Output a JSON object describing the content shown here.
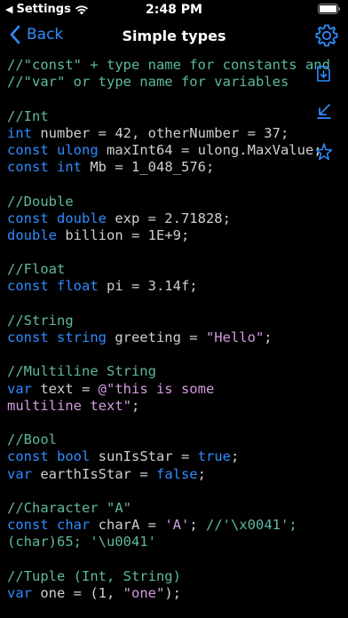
{
  "status": {
    "back_app": "Settings",
    "time": "2:48 PM"
  },
  "nav": {
    "back_label": "Back",
    "title": "Simple types"
  },
  "colors": {
    "accent": "#2f8cff",
    "comment": "#5fb8a0",
    "string": "#d39be0",
    "text": "#cfcfcf",
    "background": "#000000"
  },
  "icons": {
    "settings": "gear-icon",
    "tool1": "page-export-icon",
    "tool2": "collapse-arrow-icon",
    "tool3": "sparkle-star-icon"
  },
  "code": {
    "lines": [
      [
        {
          "t": "comment",
          "v": "//\"const\" + type name for constants and"
        }
      ],
      [
        {
          "t": "comment",
          "v": "//\"var\" or type name for variables"
        }
      ],
      [],
      [
        {
          "t": "comment",
          "v": "//Int"
        }
      ],
      [
        {
          "t": "keyword",
          "v": "int"
        },
        {
          "t": "plain",
          "v": " number = 42, otherNumber = 37;"
        }
      ],
      [
        {
          "t": "keyword",
          "v": "const ulong"
        },
        {
          "t": "plain",
          "v": " maxInt64 = ulong.MaxValue;"
        }
      ],
      [
        {
          "t": "keyword",
          "v": "const int"
        },
        {
          "t": "plain",
          "v": " Mb = 1_048_576;"
        }
      ],
      [],
      [
        {
          "t": "comment",
          "v": "//Double"
        }
      ],
      [
        {
          "t": "keyword",
          "v": "const double"
        },
        {
          "t": "plain",
          "v": " exp = 2.71828;"
        }
      ],
      [
        {
          "t": "keyword",
          "v": "double"
        },
        {
          "t": "plain",
          "v": " billion = 1E+9;"
        }
      ],
      [],
      [
        {
          "t": "comment",
          "v": "//Float"
        }
      ],
      [
        {
          "t": "keyword",
          "v": "const float"
        },
        {
          "t": "plain",
          "v": " pi = 3.14f;"
        }
      ],
      [],
      [
        {
          "t": "comment",
          "v": "//String"
        }
      ],
      [
        {
          "t": "keyword",
          "v": "const string"
        },
        {
          "t": "plain",
          "v": " greeting = "
        },
        {
          "t": "string",
          "v": "\"Hello\""
        },
        {
          "t": "plain",
          "v": ";"
        }
      ],
      [],
      [
        {
          "t": "comment",
          "v": "//Multiline String"
        }
      ],
      [
        {
          "t": "keyword",
          "v": "var"
        },
        {
          "t": "plain",
          "v": " text = "
        },
        {
          "t": "string",
          "v": "@\"this is some"
        }
      ],
      [
        {
          "t": "string",
          "v": "multiline text\""
        },
        {
          "t": "plain",
          "v": ";"
        }
      ],
      [],
      [
        {
          "t": "comment",
          "v": "//Bool"
        }
      ],
      [
        {
          "t": "keyword",
          "v": "const bool"
        },
        {
          "t": "plain",
          "v": " sunIsStar = "
        },
        {
          "t": "keyword",
          "v": "true"
        },
        {
          "t": "plain",
          "v": ";"
        }
      ],
      [
        {
          "t": "keyword",
          "v": "var"
        },
        {
          "t": "plain",
          "v": " earthIsStar = "
        },
        {
          "t": "keyword",
          "v": "false"
        },
        {
          "t": "plain",
          "v": ";"
        }
      ],
      [],
      [
        {
          "t": "comment",
          "v": "//Character \"A\""
        }
      ],
      [
        {
          "t": "keyword",
          "v": "const char"
        },
        {
          "t": "plain",
          "v": " charA = "
        },
        {
          "t": "string",
          "v": "'A'"
        },
        {
          "t": "plain",
          "v": "; "
        },
        {
          "t": "comment",
          "v": "//'\\x0041';"
        }
      ],
      [
        {
          "t": "comment",
          "v": "(char)65; '\\u0041'"
        }
      ],
      [],
      [
        {
          "t": "comment",
          "v": "//Tuple (Int, String)"
        }
      ],
      [
        {
          "t": "keyword",
          "v": "var"
        },
        {
          "t": "plain",
          "v": " one = (1, "
        },
        {
          "t": "string",
          "v": "\"one\""
        },
        {
          "t": "plain",
          "v": ");"
        }
      ]
    ]
  }
}
